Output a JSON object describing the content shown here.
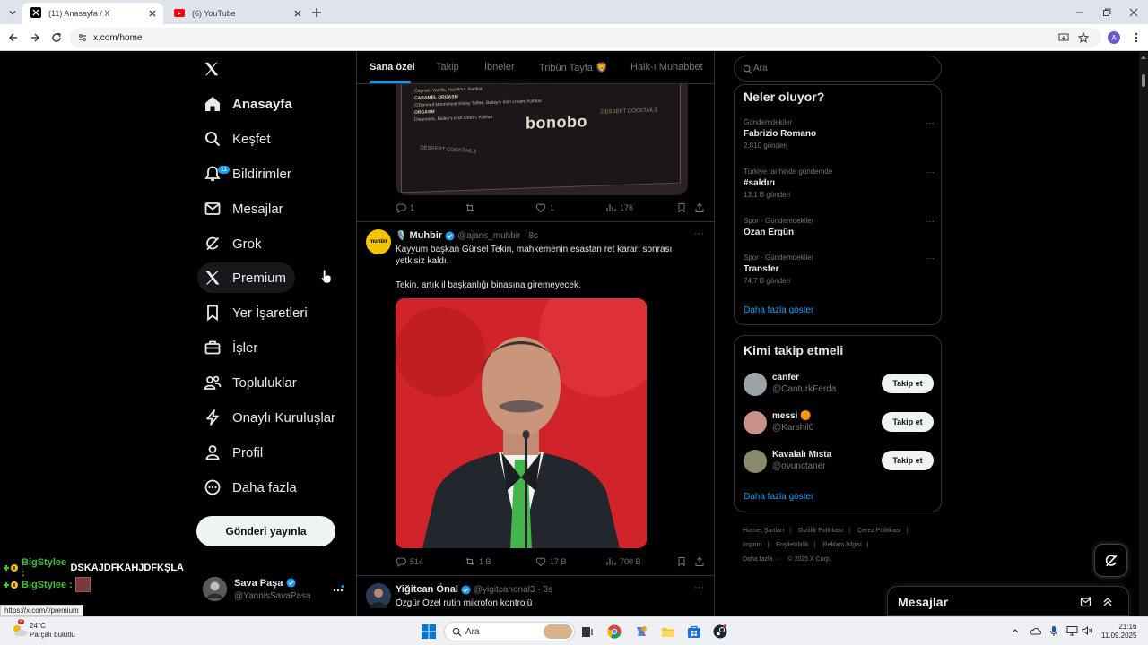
{
  "browser": {
    "tabs": [
      {
        "title": "(11) Anasayfa / X",
        "active": true
      },
      {
        "title": "(6) YouTube",
        "active": false
      }
    ],
    "url": "x.com/home",
    "profile_letter": "A",
    "status_url": "https://x.com/i/premium"
  },
  "sidebar": {
    "logo": "x-logo",
    "items": [
      {
        "label": "Anasayfa",
        "icon": "home-icon",
        "bold": true
      },
      {
        "label": "Keşfet",
        "icon": "search-icon"
      },
      {
        "label": "Bildirimler",
        "icon": "bell-icon",
        "badge": "11"
      },
      {
        "label": "Mesajlar",
        "icon": "mail-icon"
      },
      {
        "label": "Grok",
        "icon": "grok-icon"
      },
      {
        "label": "Premium",
        "icon": "x-premium-icon"
      },
      {
        "label": "Yer İşaretleri",
        "icon": "bookmark-icon"
      },
      {
        "label": "İşler",
        "icon": "briefcase-icon"
      },
      {
        "label": "Topluluklar",
        "icon": "people-icon"
      },
      {
        "label": "Onaylı Kuruluşlar",
        "icon": "lightning-icon"
      },
      {
        "label": "Profil",
        "icon": "person-icon"
      },
      {
        "label": "Daha fazla",
        "icon": "more-circle-icon"
      }
    ],
    "post_button": "Gönderi yayınla",
    "account": {
      "name": "Sava Paşa",
      "handle": "@YannisSavaPasa"
    }
  },
  "chat_overlay": [
    {
      "user": "BigStylee :",
      "message": "DSKAJDFKAHJDFKŞLA"
    },
    {
      "user": "BigStylee :",
      "message": ""
    }
  ],
  "feed": {
    "tabs": [
      "Sana özel",
      "Takip",
      "İbneler",
      "Tribün Tayfa 🦁",
      "Halk-ı Muhabbet"
    ],
    "menu_image": {
      "lines": [
        "Cognac, Vanilla, Hazelnut, Kahlua",
        "CARAMEL ORGASM",
        "O'Donnell Moonshine Sticky Toffee, Bailey's Irish cream, Kahlua",
        "ORGASM",
        "Disaronno, Bailey's Irish cream, Kahlua"
      ],
      "brand": "bonobo",
      "label_left": "DESSERT COCKTAILS",
      "label_right": "DESSERT COCKTAILS"
    },
    "post1_actions": {
      "replies": "1",
      "reposts": "",
      "likes": "1",
      "views": "176"
    },
    "post2": {
      "emoji": "🎙️",
      "name": "Muhbir",
      "handle": "@ajans_muhbir",
      "time": "· 8s",
      "text1": "Kayyum başkan Gürsel Tekin, mahkemenin esastan ret kararı sonrası yetkisiz kaldı.",
      "text2": "Tekin, artık il başkanlığı binasına giremeyecek.",
      "avatar_text": "muhbir",
      "actions": {
        "replies": "514",
        "reposts": "1 B",
        "likes": "17 B",
        "views": "700 B"
      }
    },
    "post3": {
      "name": "Yiğitcan Önal",
      "handle": "@yigitcanonal3",
      "time": "· 3s",
      "text": "Özgür Özel rutin mikrofon kontrolü"
    }
  },
  "right": {
    "search_placeholder": "Ara",
    "trends_title": "Neler oluyor?",
    "trends": [
      {
        "category": "Gündemdekiler",
        "title": "Fabrizio Romano",
        "count": "2.810 gönderi"
      },
      {
        "category": "Türkiye tarihinde gündemde",
        "title": "#saldırı",
        "count": "13,1 B gönderi"
      },
      {
        "category": "Spor · Gündemdekiler",
        "title": "Ozan Ergün",
        "count": ""
      },
      {
        "category": "Spor · Gündemdekiler",
        "title": "Transfer",
        "count": "74,7 B gönderi"
      }
    ],
    "show_more": "Daha fazla göster",
    "wtf_title": "Kimi takip etmeli",
    "wtf": [
      {
        "name": "canfer",
        "handle": "@CanturkFerda",
        "button": "Takip et",
        "avatar_color": "#9ba3a8"
      },
      {
        "name": "messi 🟠",
        "handle": "@Karshil0",
        "button": "Takip et",
        "avatar_color": "#c98f8a"
      },
      {
        "name": "Kavalalı Mısta",
        "handle": "@ovunctaner",
        "button": "Takip et",
        "avatar_color": "#8a8a6a"
      }
    ],
    "wtf_show_more": "Daha fazla göster",
    "footer": [
      "Hizmet Şartları",
      "|",
      "Gizlilik Politikası",
      "|",
      "Çerez Politikası",
      "|",
      "Imprint",
      "|",
      "Erişilebilirlik",
      "|",
      "Reklam bilgisi",
      "|",
      "Daha fazla ···",
      "© 2025 X Corp."
    ]
  },
  "messages_drawer": {
    "title": "Mesajlar"
  },
  "taskbar": {
    "weather_temp": "24°C",
    "weather_desc": "Parçalı bulutlu",
    "weather_badge": "4",
    "search_placeholder": "Ara",
    "time": "21:16",
    "date": "11.09.2025"
  },
  "colors": {
    "accent": "#1d9bf0",
    "background": "#000000",
    "border": "#2f3336",
    "muted": "#71767b"
  }
}
